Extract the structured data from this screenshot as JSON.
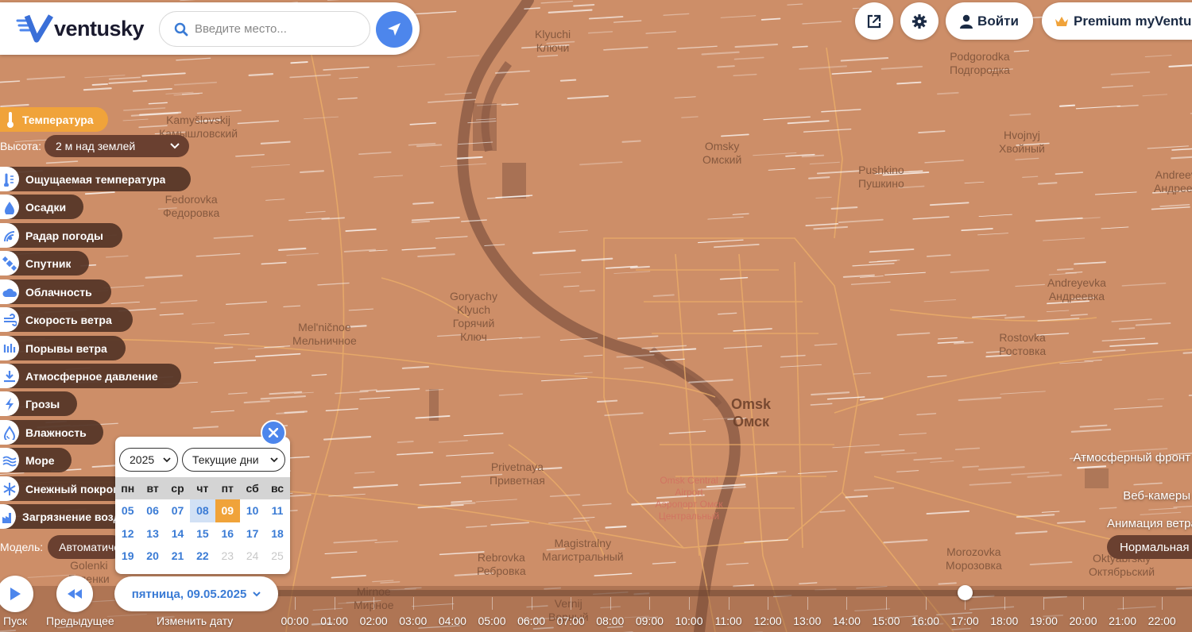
{
  "brand": {
    "name": "ventusky"
  },
  "search": {
    "placeholder": "Введите место..."
  },
  "header": {
    "login_label": "Войти",
    "premium_label": "Premium myVentusky"
  },
  "layers": {
    "active": {
      "label": "Температура",
      "icon": "thermometer-icon"
    },
    "height_label": "Высота:",
    "height_value": "2 м над землей",
    "items": [
      {
        "label": "Ощущаемая температура",
        "icon": "feels-like-icon"
      },
      {
        "label": "Осадки",
        "icon": "drop-icon"
      },
      {
        "label": "Радар погоды",
        "icon": "radar-icon"
      },
      {
        "label": "Спутник",
        "icon": "satellite-icon"
      },
      {
        "label": "Облачность",
        "icon": "cloud-icon"
      },
      {
        "label": "Скорость ветра",
        "icon": "wind-icon"
      },
      {
        "label": "Порывы ветра",
        "icon": "gust-icon"
      },
      {
        "label": "Атмосферное давление",
        "icon": "pressure-icon"
      },
      {
        "label": "Грозы",
        "icon": "lightning-icon"
      },
      {
        "label": "Влажность",
        "icon": "humidity-icon"
      },
      {
        "label": "Море",
        "icon": "waves-icon"
      },
      {
        "label": "Снежный покров",
        "icon": "snowflake-icon"
      },
      {
        "label": "Загрязнение воздуха",
        "icon": "factory-icon"
      }
    ],
    "model_label": "Модель:",
    "model_value": "Автоматически"
  },
  "calendar": {
    "year": "2025",
    "range": "Текущие дни",
    "weekdays": [
      "пн",
      "вт",
      "ср",
      "чт",
      "пт",
      "сб",
      "вс"
    ],
    "weeks": [
      [
        "05",
        "06",
        "07",
        "08",
        "09",
        "10",
        "11"
      ],
      [
        "12",
        "13",
        "14",
        "15",
        "16",
        "17",
        "18"
      ],
      [
        "19",
        "20",
        "21",
        "22",
        "23",
        "24",
        "25"
      ]
    ],
    "today": "08",
    "selected": "09",
    "unavailable": [
      "23",
      "24",
      "25"
    ]
  },
  "controls": {
    "play_label": "Пуск",
    "prev_label": "Предыдущее",
    "date_label": "пятница, 09.05.2025",
    "change_date_label": "Изменить дату"
  },
  "timeline": {
    "hours": [
      "00:00",
      "01:00",
      "02:00",
      "03:00",
      "04:00",
      "05:00",
      "06:00",
      "07:00",
      "08:00",
      "09:00",
      "10:00",
      "11:00",
      "12:00",
      "13:00",
      "14:00",
      "15:00",
      "16:00",
      "17:00",
      "18:00",
      "19:00",
      "20:00",
      "21:00",
      "22:00"
    ],
    "current_hour": "17:00"
  },
  "right_panel": {
    "front_label": "Атмосферный фронт",
    "webcams_label": "Веб-камеры",
    "animation_label": "Анимация ветра",
    "speed_value": "Нормальная"
  },
  "map": {
    "places": [
      {
        "lat": "Klyuchi",
        "cyr": "Ключи"
      },
      {
        "lat": "Podgorodka",
        "cyr": "Подгородка"
      },
      {
        "lat": "Kamyšlovskij",
        "cyr": "Камышловский"
      },
      {
        "lat": "Omsky",
        "cyr": "Омский"
      },
      {
        "lat": "Hvojnyj",
        "cyr": "Хвойный"
      },
      {
        "lat": "Andreevka",
        "cyr": "Андреевка"
      },
      {
        "lat": "Pushkino",
        "cyr": "Пушкино"
      },
      {
        "lat": "Fedorovka",
        "cyr": "Федоровка"
      },
      {
        "lat": "Andreyevka",
        "cyr": "Андреевка"
      },
      {
        "lat": "Goryachy Klyuch",
        "cyr": "Горячий Ключ"
      },
      {
        "lat": "Mel'ničnoe",
        "cyr": "Мельничное"
      },
      {
        "lat": "Rostovka",
        "cyr": "Ростовка"
      },
      {
        "lat": "Omsk",
        "cyr": "Омск"
      },
      {
        "lat": "Privetnaya",
        "cyr": "Приветная"
      },
      {
        "lat": "Magistralny",
        "cyr": "Магистральный"
      },
      {
        "lat": "Rebrovka",
        "cyr": "Ребровка"
      },
      {
        "lat": "Morozovka",
        "cyr": "Морозовка"
      },
      {
        "lat": "Oktyabrskiy",
        "cyr": "Октябрьский"
      },
      {
        "lat": "Golenki",
        "cyr": "Голенки"
      },
      {
        "lat": "Mirnoe",
        "cyr": "Мирное"
      },
      {
        "lat": "Vernij",
        "cyr": "Верный"
      }
    ],
    "airport": {
      "lat": "Omsk Central Airport",
      "cyr": "Аэропорт Омск Центральный"
    }
  },
  "colors": {
    "accent": "#f0a33a",
    "link_blue": "#3a7bd5",
    "button_blue": "#4d86ec",
    "map_fill": "#c98a64",
    "menu_bg": "#543426"
  }
}
